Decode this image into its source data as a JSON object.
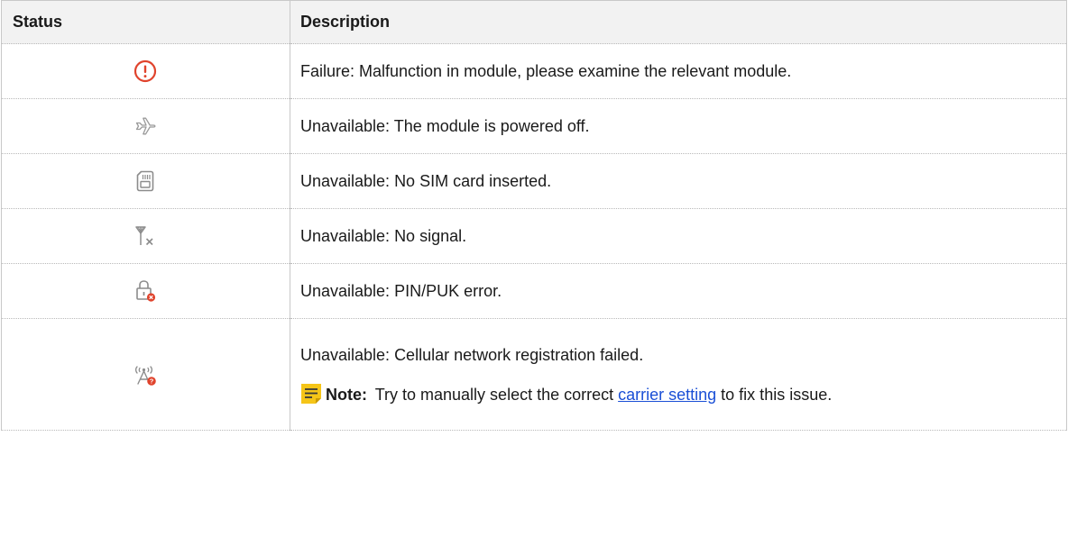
{
  "table": {
    "headers": {
      "status": "Status",
      "description": "Description"
    },
    "rows": [
      {
        "icon": "failure-exclamation-icon",
        "icon_color": "#e0432c",
        "description": "Failure: Malfunction in module, please examine the relevant module."
      },
      {
        "icon": "airplane-mode-icon",
        "icon_color": "#9a9a9a",
        "description": "Unavailable: The module is powered off."
      },
      {
        "icon": "sim-card-icon",
        "icon_color": "#8c8c8c",
        "description": "Unavailable: No SIM card inserted."
      },
      {
        "icon": "no-signal-antenna-icon",
        "icon_color": "#8c8c8c",
        "description": "Unavailable: No signal."
      },
      {
        "icon": "lock-error-icon",
        "icon_color": "#8c8c8c",
        "description": "Unavailable: PIN/PUK error."
      },
      {
        "icon": "cellular-registration-failed-icon",
        "icon_color": "#8c8c8c",
        "description": "Unavailable: Cellular network registration failed.",
        "note": {
          "label": "Note:",
          "text_before": "Try to manually select the correct ",
          "link_text": "carrier setting",
          "text_after": " to fix this issue."
        }
      }
    ]
  },
  "colors": {
    "header_bg": "#f2f2f2",
    "border": "#c8c8c8",
    "error_red": "#e0432c",
    "note_yellow": "#f5c518",
    "link_blue": "#1a4fd6"
  }
}
